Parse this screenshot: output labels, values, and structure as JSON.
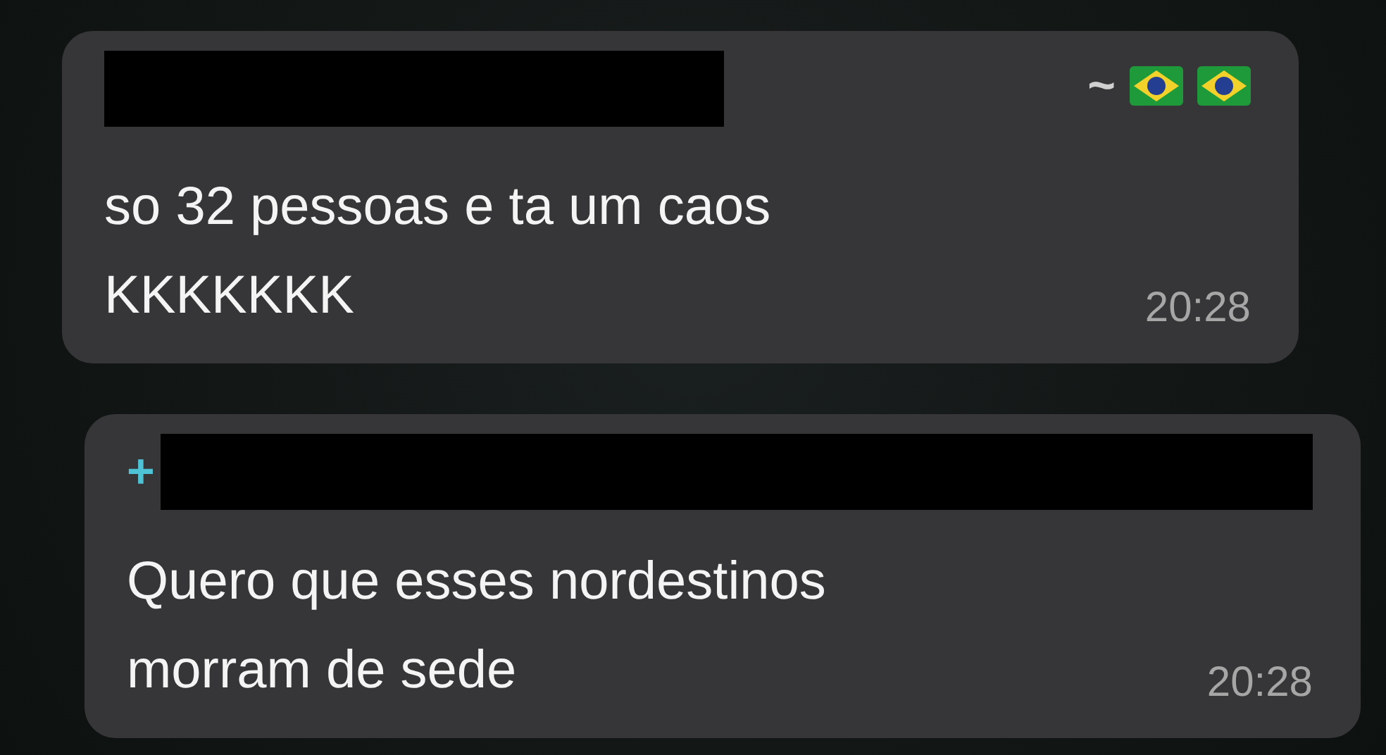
{
  "messages": [
    {
      "sender": {
        "prefix": "~",
        "color": "#d0d0d0",
        "redacted": true,
        "badges": [
          {
            "kind": "flag"
          },
          {
            "kind": "flag"
          }
        ]
      },
      "lines": [
        "so 32 pessoas e ta um caos",
        "KKKKKKK"
      ],
      "time": "20:28",
      "indent": false
    },
    {
      "sender": {
        "prefix": "+",
        "color": "#4fc3d6",
        "redacted": true
      },
      "lines": [
        "Quero que esses nordestinos",
        "morram de sede"
      ],
      "time": "20:28",
      "indent": true
    }
  ]
}
